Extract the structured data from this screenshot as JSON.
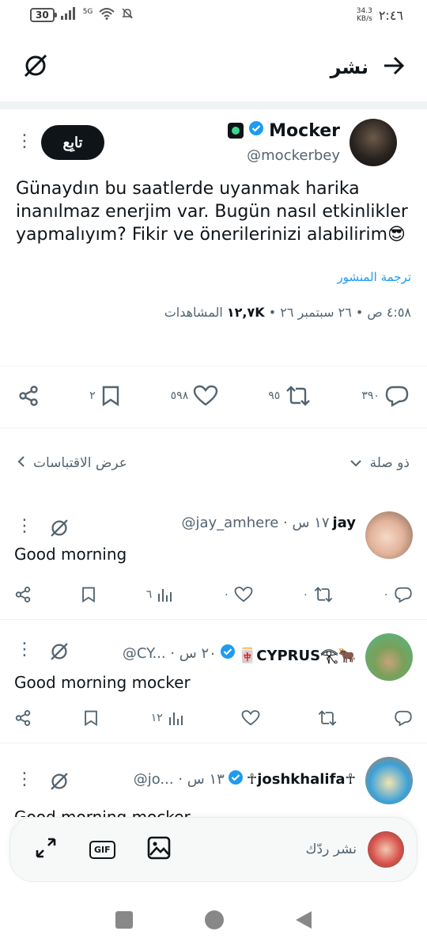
{
  "status_bar": {
    "battery": "30",
    "signal_label": "5G",
    "net_speed_value": "34.3",
    "net_speed_unit": "KB/s",
    "time": "٢:٤٦"
  },
  "header": {
    "title": "نشر",
    "back_icon": "arrow-right-icon",
    "grok_icon": "grok-slash-icon"
  },
  "post": {
    "author_name": "Mocker",
    "handle": "@mockerbey",
    "follow_label": "تابِع",
    "text": "Günaydın bu saatlerde uyanmak harika inanılmaz enerjim var. Bugün nasıl etkinlikler yapmalıyım? Fikir ve önerilerinizi alabilirim😎",
    "translate_label": "ترجمة المنشور",
    "timestamp": "٤:٥٨ ص • ٢٦ سبتمبر ٢٦ •",
    "views_count": "١٢,٧K",
    "views_label": "المشاهدات",
    "replies": "٣٩٠",
    "reposts": "٩٥",
    "likes": "٥٩٨",
    "bookmarks": "٢"
  },
  "filter": {
    "relevance_label": "ذو صلة",
    "quotes_label": "عرض الاقتباسات"
  },
  "replies": [
    {
      "name": "jay",
      "meta": "@jay_amhere · ١٧ س",
      "text": "Good morning",
      "views": "٦",
      "likes": "٠",
      "reposts": "٠",
      "replies": "٠"
    },
    {
      "name": "🀄CYPRUS𓂀🐂",
      "meta": "@CY... · ٢٠ س",
      "text": "Good morning mocker",
      "views": "١٢",
      "likes": "",
      "reposts": "",
      "replies": ""
    },
    {
      "name": "☥joshkhalifa☥",
      "meta": "@jo... · ١٣ س",
      "text": "Good morning mocker",
      "views": "",
      "likes": "",
      "reposts": "",
      "replies": ""
    }
  ],
  "composer": {
    "placeholder": "نشر ردّك",
    "gif_label": "GIF"
  },
  "colors": {
    "accent": "#1d9bf0",
    "text": "#0f1419",
    "muted": "#536471",
    "verified": "#1d9bf0"
  }
}
